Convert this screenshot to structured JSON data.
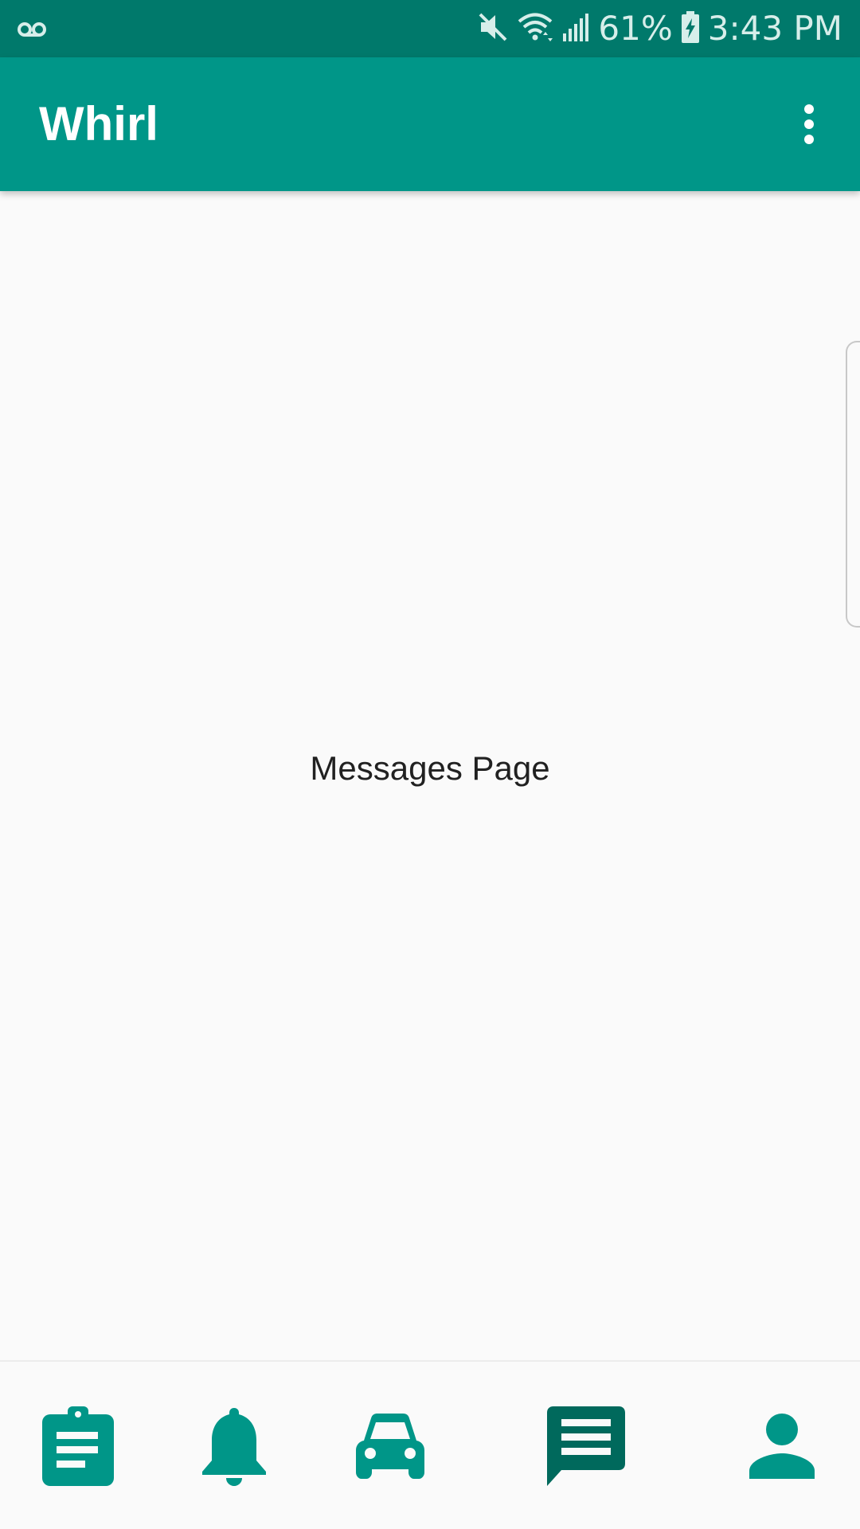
{
  "status_bar": {
    "left_icon": "voicemail-icon",
    "right_icons": [
      "mute-icon",
      "wifi-icon",
      "signal-icon",
      "battery-charging-icon"
    ],
    "battery": "61%",
    "time": "3:43 PM"
  },
  "app_bar": {
    "title": "Whirl",
    "menu_icon": "more-vert-icon"
  },
  "content": {
    "text": "Messages Page"
  },
  "bottom_nav": {
    "items": [
      {
        "icon": "assignment-icon",
        "active": false
      },
      {
        "icon": "notifications-icon",
        "active": false
      },
      {
        "icon": "car-icon",
        "active": false
      },
      {
        "icon": "message-icon",
        "active": true
      },
      {
        "icon": "person-icon",
        "active": false
      }
    ]
  },
  "colors": {
    "primary": "#009688",
    "primary_dark": "#00796B",
    "active_tab": "#00695C",
    "background": "#FAFAFA",
    "text": "#212121"
  }
}
